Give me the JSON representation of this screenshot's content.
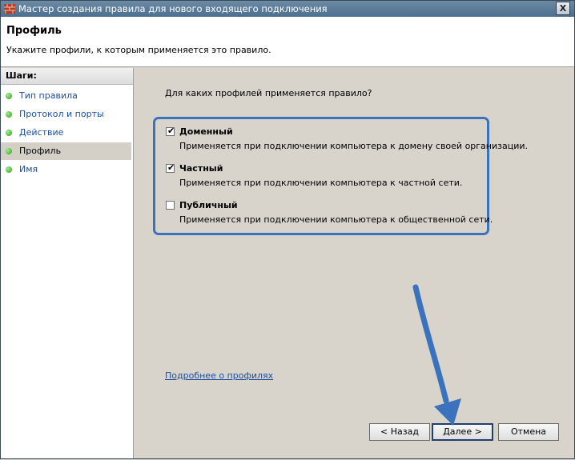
{
  "window": {
    "title": "Мастер создания правила для нового входящего подключения",
    "close_label": "X"
  },
  "header": {
    "title": "Профиль",
    "description": "Укажите профили, к которым применяется это правило."
  },
  "sidebar": {
    "heading": "Шаги:",
    "steps": [
      {
        "label": "Тип правила",
        "active": false
      },
      {
        "label": "Протокол и порты",
        "active": false
      },
      {
        "label": "Действие",
        "active": false
      },
      {
        "label": "Профиль",
        "active": true
      },
      {
        "label": "Имя",
        "active": false
      }
    ]
  },
  "main": {
    "question": "Для каких профилей применяется правило?",
    "profiles": [
      {
        "name": "Доменный",
        "description": "Применяется при подключении компьютера к домену своей организации.",
        "checked": true
      },
      {
        "name": "Частный",
        "description": "Применяется при подключении компьютера к частной сети.",
        "checked": true
      },
      {
        "name": "Публичный",
        "description": "Применяется при подключении компьютера к общественной сети.",
        "checked": false
      }
    ],
    "help_link": "Подробнее о профилях"
  },
  "buttons": {
    "back": "< Назад",
    "next": "Далее >",
    "cancel": "Отмена"
  },
  "icons": {
    "app": "firewall-brick-icon",
    "checkbox_mark": "✔",
    "steps_dot": "green-dot-icon"
  },
  "colors": {
    "highlight_border": "#3a72bd",
    "link": "#1c4fa0",
    "arrow": "#3a72bd"
  }
}
